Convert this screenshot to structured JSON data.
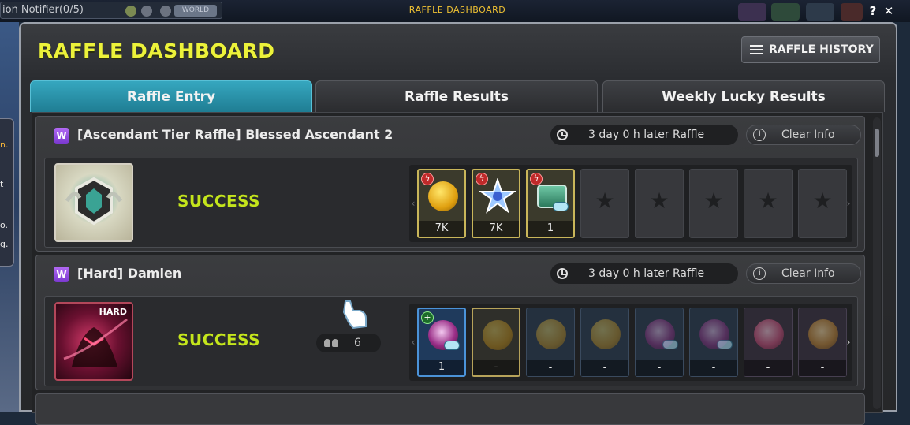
{
  "background": {
    "notifier_label": "ion Notifier(0/5)",
    "world_badge": "WORLD",
    "side_texts": [
      "n.",
      "t",
      "o.",
      "g."
    ]
  },
  "window": {
    "titlebar": "RAFFLE DASHBOARD",
    "help_label": "?",
    "close_label": "✕",
    "title": "RAFFLE DASHBOARD",
    "history_button": "RAFFLE HISTORY"
  },
  "tabs": [
    {
      "label": "Raffle Entry",
      "active": true
    },
    {
      "label": "Raffle Results",
      "active": false
    },
    {
      "label": "Weekly Lucky Results",
      "active": false
    }
  ],
  "raffles": [
    {
      "badge": "W",
      "title": "[Ascendant Tier Raffle] Blessed Ascendant 2",
      "timer": "3 day 0 h later Raffle",
      "clear_info": "Clear Info",
      "status": "SUCCESS",
      "boss_icon": "ascendant-emblem-icon",
      "rewards": [
        {
          "icon": "gold-coin-icon",
          "qty": "7K"
        },
        {
          "icon": "star-crystal-icon",
          "qty": "7K"
        },
        {
          "icon": "treasure-chest-icon",
          "qty": "1"
        }
      ],
      "empty_slots": 5
    },
    {
      "badge": "W",
      "title": "[Hard] Damien",
      "timer": "3 day 0 h later Raffle",
      "clear_info": "Clear Info",
      "status": "SUCCESS",
      "boss_tag": "HARD",
      "boss_icon": "damien-portrait-icon",
      "party_count": "6",
      "rewards": [
        {
          "icon": "purple-orb-icon",
          "qty": "1"
        },
        {
          "icon": "gold-coin-icon",
          "qty": "-"
        },
        {
          "icon": "gold-coin-icon",
          "qty": "-"
        },
        {
          "icon": "gold-coin-icon",
          "qty": "-"
        },
        {
          "icon": "purple-orb-icon",
          "qty": "-"
        },
        {
          "icon": "purple-orb-icon",
          "qty": "-"
        },
        {
          "icon": "pink-orb-icon",
          "qty": "-"
        },
        {
          "icon": "gold-orb-icon",
          "qty": "-"
        }
      ]
    }
  ],
  "colors": {
    "title_yellow": "#ecf23a",
    "success_green": "#c4e51c",
    "active_tab": "#2a95ad"
  }
}
